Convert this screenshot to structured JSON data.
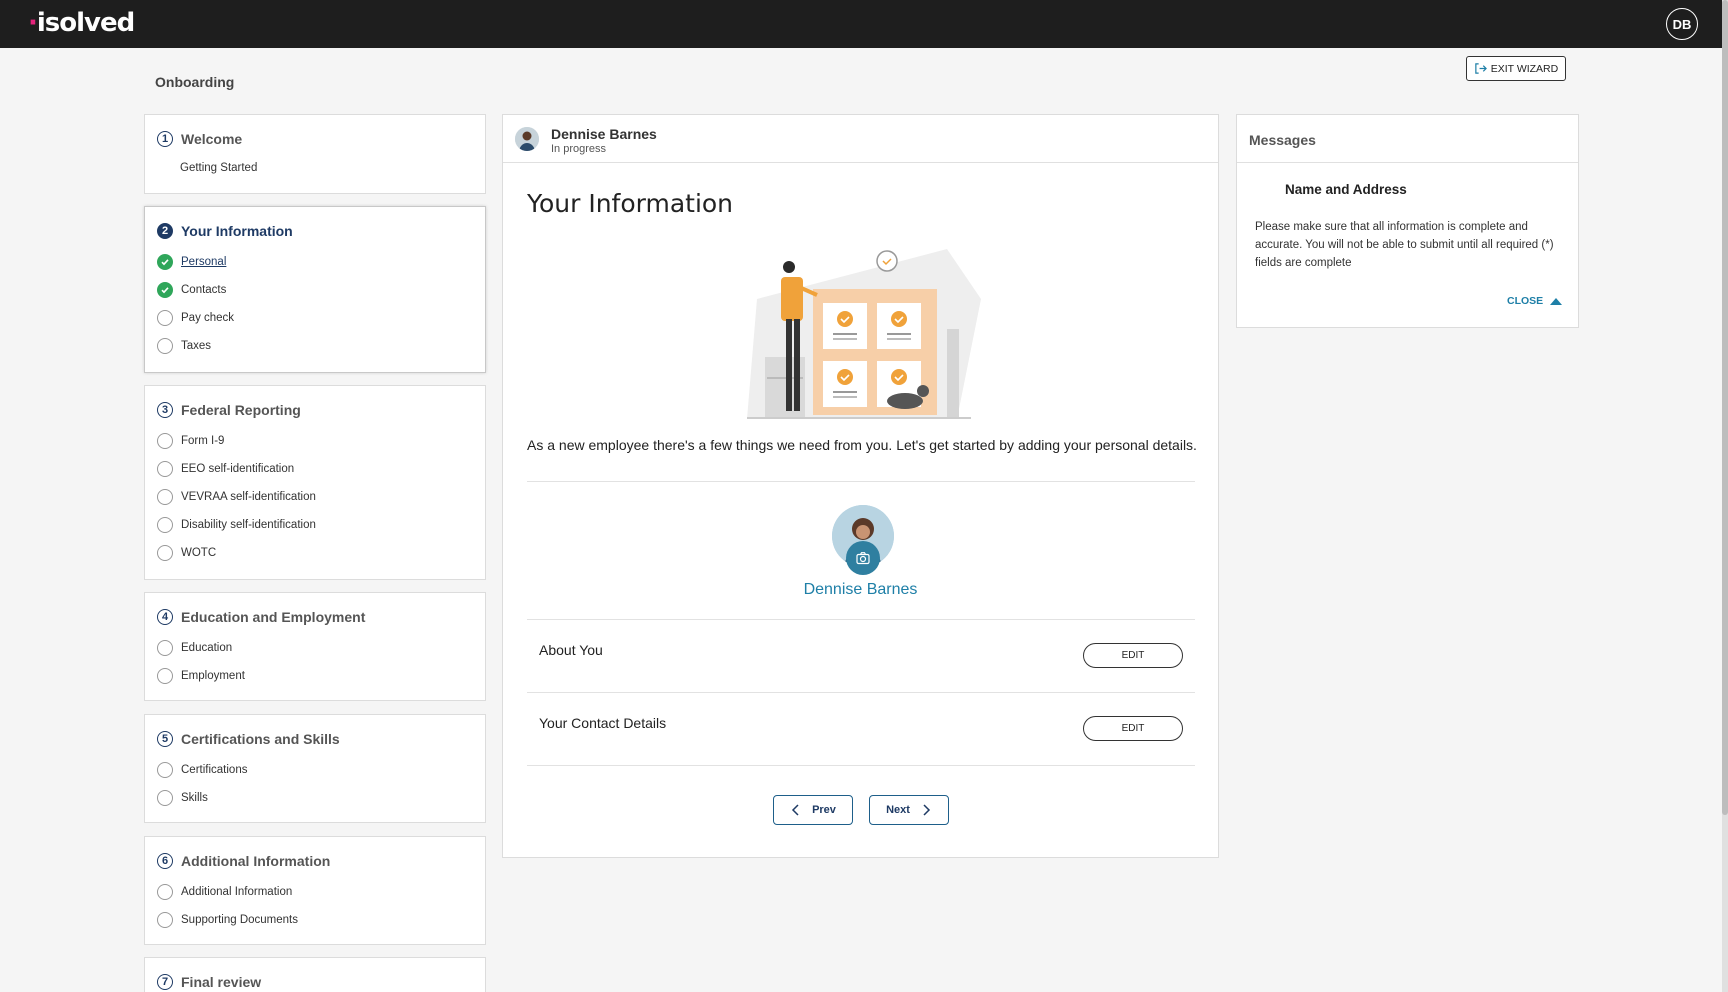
{
  "topbar": {
    "logo": "isolved",
    "user_initials": "DB"
  },
  "page": {
    "title": "Onboarding",
    "exit_label": "EXIT WIZARD"
  },
  "sidebar": {
    "sections": [
      {
        "num": "1",
        "title": "Welcome",
        "items": [
          {
            "label": "Getting Started",
            "status": "none"
          }
        ]
      },
      {
        "num": "2",
        "title": "Your Information",
        "items": [
          {
            "label": "Personal",
            "status": "complete"
          },
          {
            "label": "Contacts",
            "status": "complete"
          },
          {
            "label": "Pay check",
            "status": "pending"
          },
          {
            "label": "Taxes",
            "status": "pending"
          }
        ]
      },
      {
        "num": "3",
        "title": "Federal Reporting",
        "items": [
          {
            "label": "Form I-9",
            "status": "pending"
          },
          {
            "label": "EEO self-identification",
            "status": "pending"
          },
          {
            "label": "VEVRAA self-identification",
            "status": "pending"
          },
          {
            "label": "Disability self-identification",
            "status": "pending"
          },
          {
            "label": "WOTC",
            "status": "pending"
          }
        ]
      },
      {
        "num": "4",
        "title": "Education and Employment",
        "items": [
          {
            "label": "Education",
            "status": "pending"
          },
          {
            "label": "Employment",
            "status": "pending"
          }
        ]
      },
      {
        "num": "5",
        "title": "Certifications and Skills",
        "items": [
          {
            "label": "Certifications",
            "status": "pending"
          },
          {
            "label": "Skills",
            "status": "pending"
          }
        ]
      },
      {
        "num": "6",
        "title": "Additional Information",
        "items": [
          {
            "label": "Additional Information",
            "status": "pending"
          },
          {
            "label": "Supporting Documents",
            "status": "pending"
          }
        ]
      },
      {
        "num": "7",
        "title": "Final review",
        "items": []
      }
    ]
  },
  "main": {
    "employee_name": "Dennise Barnes",
    "status": "In progress",
    "heading": "Your Information",
    "intro": "As a new employee there's a few things we need from you. Let's get started by adding your personal details.",
    "profile_name": "Dennise Barnes",
    "rows": [
      {
        "label": "About You",
        "button": "EDIT"
      },
      {
        "label": "Your Contact Details",
        "button": "EDIT"
      }
    ],
    "prev_label": "Prev",
    "next_label": "Next"
  },
  "messages": {
    "title": "Messages",
    "msg_title": "Name and Address",
    "msg_text": "Please make sure that all information is complete and accurate. You will not be able to submit until all required (*) fields are complete",
    "close_label": "CLOSE"
  },
  "colors": {
    "accent": "#1e7fa7",
    "navy": "#1e3a64",
    "success": "#2fa65a",
    "illustration": "#f0a23a"
  }
}
